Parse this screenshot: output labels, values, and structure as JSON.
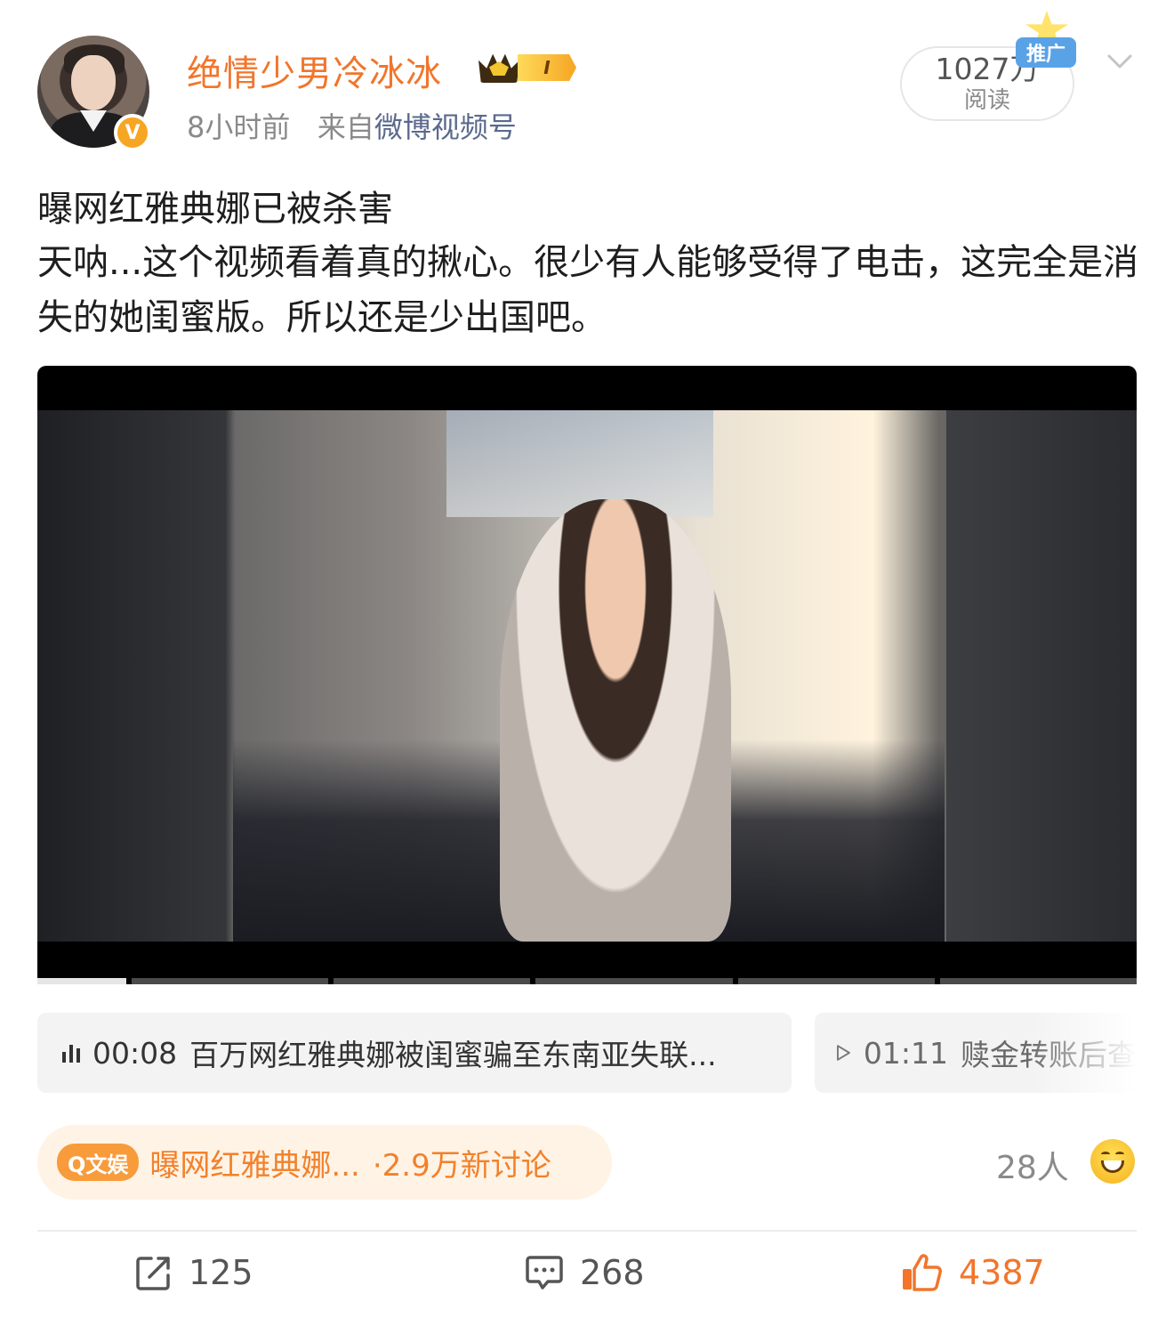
{
  "post": {
    "username": "绝情少男冷冰冰",
    "rank_badge": "I",
    "verified_badge": "V",
    "time": "8小时前",
    "source_prefix": "来自",
    "source": "微博视频号",
    "reads_value": "1027万",
    "reads_label": "阅读",
    "promo_label": "推广",
    "title": "曝网红雅典娜已被杀害",
    "body": "天呐...这个视频看着真的揪心。很少有人能够受得了电击，这完全是消失的她闺蜜版。所以还是少出国吧。"
  },
  "chips": [
    {
      "time": "00:08",
      "text": "百万网红雅典娜被闺蜜骗至东南亚失联..."
    },
    {
      "time": "01:11",
      "text": "赎金转账后查"
    }
  ],
  "topic": {
    "tag": "Q文娱",
    "text": "曝网红雅典娜...",
    "count": "·2.9万新讨论"
  },
  "people": "28人",
  "actions": {
    "share_count": "125",
    "comment_count": "268",
    "like_count": "4387"
  },
  "colors": {
    "username": "#f2752b",
    "source_link": "#5b6a8c",
    "like": "#f2752b",
    "topic_bg": "#fff3e6"
  },
  "icons": [
    "verified-icon",
    "rank-badge-icon",
    "promo-icon",
    "chevron-down-icon",
    "audio-bars-icon",
    "play-icon",
    "emoji-icon",
    "share-icon",
    "comment-icon",
    "like-icon"
  ]
}
